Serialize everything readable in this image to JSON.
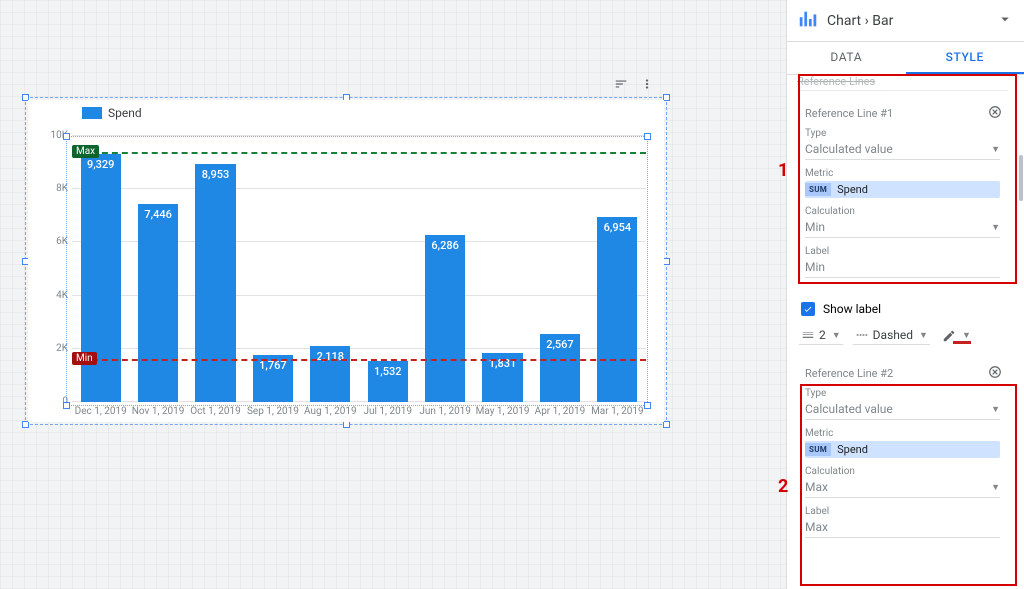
{
  "chart_data": {
    "type": "bar",
    "title": null,
    "xlabel": "",
    "ylabel": "",
    "ylim": [
      0,
      10000
    ],
    "yticks": [
      "0",
      "2K",
      "4K",
      "6K",
      "8K",
      "10K"
    ],
    "series": [
      {
        "name": "Spend",
        "values": [
          9329,
          7446,
          8953,
          1767,
          2118,
          1532,
          6286,
          1831,
          2567,
          6954
        ]
      }
    ],
    "categories": [
      "Dec 1, 2019",
      "Nov 1, 2019",
      "Oct 1, 2019",
      "Sep 1, 2019",
      "Aug 1, 2019",
      "Jul 1, 2019",
      "Jun 1, 2019",
      "May 1, 2019",
      "Apr 1, 2019",
      "Mar 1, 2019"
    ],
    "value_labels": [
      "9,329",
      "7,446",
      "8,953",
      "1,767",
      "2,118",
      "1,532",
      "6,286",
      "1,831",
      "2,567",
      "6,954"
    ],
    "reference_lines": [
      {
        "label": "Min",
        "value": 1532,
        "color": "#c5221f"
      },
      {
        "label": "Max",
        "value": 9329,
        "color": "#188038"
      }
    ]
  },
  "legend": {
    "label": "Spend"
  },
  "panel": {
    "breadcrumb": "Chart  ›  Bar",
    "tabs": {
      "data": "DATA",
      "style": "STYLE"
    },
    "section_title": "Reference Lines",
    "ref1": {
      "heading": "Reference Line #1",
      "type_label": "Type",
      "type_value": "Calculated value",
      "metric_label": "Metric",
      "metric_agg": "SUM",
      "metric_name": "Spend",
      "calc_label": "Calculation",
      "calc_value": "Min",
      "label_label": "Label",
      "label_value": "Min"
    },
    "show_label": "Show label",
    "line_weight": "2",
    "line_style": "Dashed",
    "ref2": {
      "heading": "Reference Line #2",
      "type_label": "Type",
      "type_value": "Calculated value",
      "metric_label": "Metric",
      "metric_agg": "SUM",
      "metric_name": "Spend",
      "calc_label": "Calculation",
      "calc_value": "Max",
      "label_label": "Label",
      "label_value": "Max"
    }
  },
  "annotations": {
    "n1": "1",
    "n2": "2"
  }
}
